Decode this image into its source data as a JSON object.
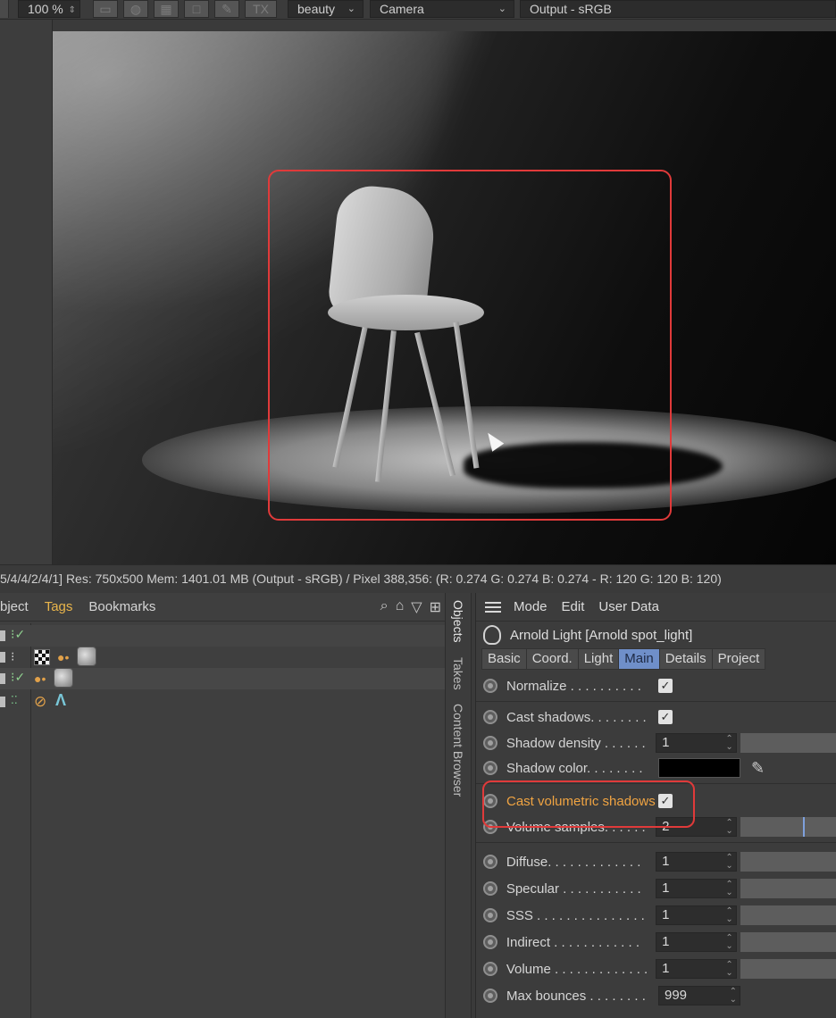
{
  "toolbar": {
    "zoom": "100 %",
    "disabled_button": "TX",
    "layer_dropdown": "beauty",
    "camera_dropdown": "Camera",
    "output_dropdown": "Output - sRGB"
  },
  "status_bar": {
    "text": "5/4/4/2/4/1]  Res: 750x500  Mem: 1401.01 MB  (Output - sRGB) / Pixel 388,356: (R: 0.274 G: 0.274 B: 0.274 - R: 120 G: 120 B: 120)"
  },
  "object_manager": {
    "menu": [
      "Object",
      "Tags",
      "Bookmarks"
    ],
    "menu_display": [
      "bject",
      "Tags",
      "Bookmarks"
    ]
  },
  "side_tabs": [
    "Objects",
    "Takes",
    "Content Browser"
  ],
  "attribute_manager": {
    "menu": [
      "Mode",
      "Edit",
      "User Data"
    ],
    "title": "Arnold Light [Arnold spot_light]",
    "tabs": [
      "Basic",
      "Coord.",
      "Light",
      "Main",
      "Details",
      "Project"
    ],
    "active_tab": "Main",
    "params": [
      {
        "label": "Normalize . . . . . . . . . .",
        "type": "check",
        "checked": true
      },
      {
        "label": "Cast shadows. . . . . . . .",
        "type": "check",
        "checked": true
      },
      {
        "label": "Shadow density . . . . . .",
        "type": "number",
        "value": "1"
      },
      {
        "label": "Shadow color. . . . . . . .",
        "type": "color",
        "value": "#000000"
      },
      {
        "label": "Cast volumetric shadows",
        "type": "check",
        "checked": true,
        "highlight": true
      },
      {
        "label": "Volume samples. . . . . .",
        "type": "number",
        "value": "2"
      },
      {
        "label": "Diffuse. . . . . . . . . . . . .",
        "type": "number",
        "value": "1"
      },
      {
        "label": "Specular  . . . . . . . . . . .",
        "type": "number",
        "value": "1"
      },
      {
        "label": "SSS  . . . . . . . . . . . . . . .",
        "type": "number",
        "value": "1"
      },
      {
        "label": "Indirect  . . . . . . . . . . . .",
        "type": "number",
        "value": "1"
      },
      {
        "label": "Volume . . . . . . . . . . . . .",
        "type": "number",
        "value": "1"
      },
      {
        "label": "Max bounces . . . . . . . .",
        "type": "number",
        "value": "999"
      }
    ]
  },
  "colors": {
    "highlight_red": "#e03a3a",
    "tab_active": "#6f8fc9",
    "tags_yellow": "#e9b54b",
    "param_orange": "#f0a442"
  }
}
